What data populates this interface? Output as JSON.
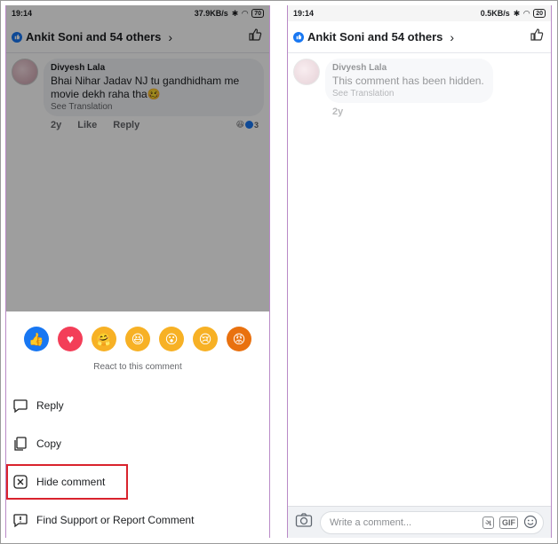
{
  "left": {
    "status": {
      "time": "19:14",
      "speed": "37.9KB/s",
      "battery": "70"
    },
    "header": {
      "title": "Ankit Soni and 54 others"
    },
    "comment": {
      "author": "Divyesh Lala",
      "text": "Bhai Nihar Jadav NJ tu gandhidham me movie dekh raha tha🥴",
      "see_translation": "See Translation",
      "age": "2y",
      "like": "Like",
      "reply": "Reply",
      "reaction_count": "3"
    },
    "sheet": {
      "emojis": [
        {
          "name": "like-reaction-icon",
          "glyph": "👍",
          "color": "#1877f2"
        },
        {
          "name": "love-reaction-icon",
          "glyph": "♥",
          "color": "#f33e58"
        },
        {
          "name": "care-reaction-icon",
          "glyph": "🤗",
          "color": "#f7b125"
        },
        {
          "name": "haha-reaction-icon",
          "glyph": "😆",
          "color": "#f7b125"
        },
        {
          "name": "wow-reaction-icon",
          "glyph": "😮",
          "color": "#f7b125"
        },
        {
          "name": "sad-reaction-icon",
          "glyph": "😢",
          "color": "#f7b125"
        },
        {
          "name": "angry-reaction-icon",
          "glyph": "😡",
          "color": "#e9710f"
        }
      ],
      "react_label": "React to this comment",
      "reply": "Reply",
      "copy": "Copy",
      "hide": "Hide comment",
      "report": "Find Support or Report Comment"
    }
  },
  "right": {
    "status": {
      "time": "19:14",
      "speed": "0.5KB/s",
      "battery": "20"
    },
    "header": {
      "title": "Ankit Soni and 54 others"
    },
    "comment": {
      "author": "Divyesh Lala",
      "text": "This comment has been hidden.",
      "see_translation": "See Translation",
      "age": "2y"
    },
    "footer": {
      "placeholder": "Write a comment...",
      "translit": "ગ",
      "gif": "GIF"
    }
  },
  "colors": {
    "accent": "#1877f2",
    "highlight": "#d9232d"
  }
}
